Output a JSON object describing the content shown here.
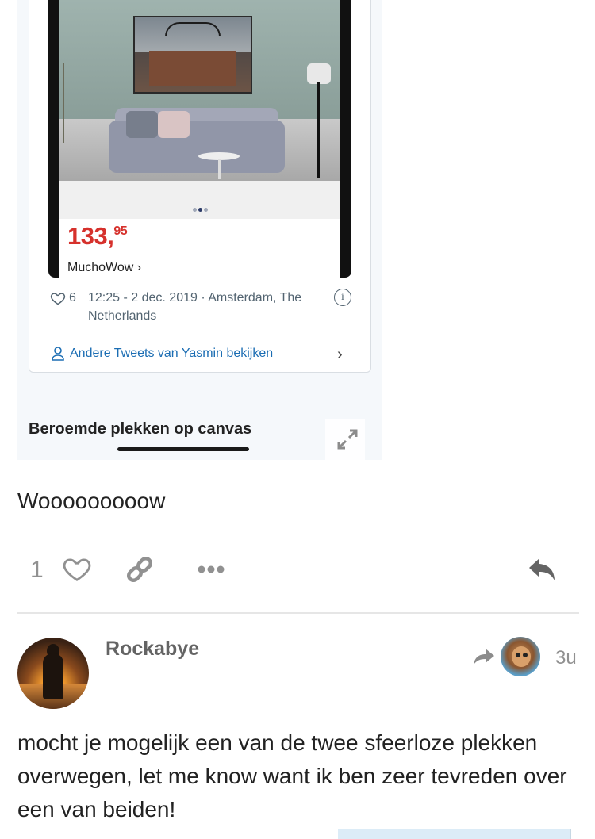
{
  "onebox": {
    "product": {
      "price_main": "133,",
      "price_cents": "95",
      "shop_link": "MuchoWow ›",
      "carousel_dots": 3,
      "carousel_active": 1
    },
    "tweet": {
      "like_count": "6",
      "timestamp": "12:25 - 2 dec. 2019 · Amsterdam, The Netherlands",
      "more_tweets_link": "Andere Tweets van Yasmin bekijken"
    },
    "title": "Beroemde plekken op canvas",
    "icons": [
      "heart-icon",
      "info-icon",
      "person-icon",
      "chevron-right-icon",
      "expand-icon"
    ]
  },
  "post": {
    "text": "Wooooooooow",
    "like_count": "1",
    "actions": [
      "heart-icon",
      "link-icon",
      "more-icon",
      "reply-icon"
    ]
  },
  "reply": {
    "username": "Rockabye",
    "age": "3u",
    "text": "mocht je mogelijk een van de twee sfeerloze plekken overwegen, let me know want ik ben zeer tevreden over een van beiden!",
    "icons": [
      "share-arrow-icon",
      "reply-to-avatar"
    ]
  },
  "colors": {
    "price_red": "#d6312c",
    "link_blue": "#1b6db3",
    "muted_grey": "#919191",
    "onebox_bg": "#f5f8fb"
  }
}
